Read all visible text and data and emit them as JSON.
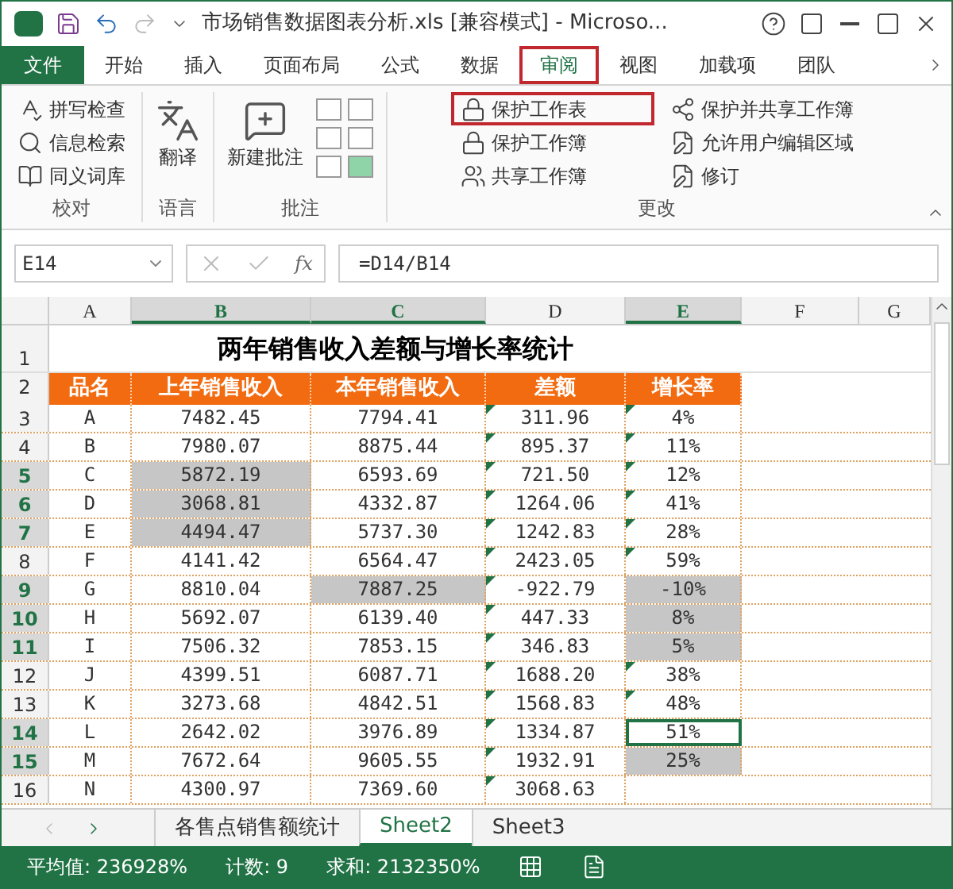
{
  "window": {
    "title": "市场销售数据图表分析.xls  [兼容模式] - Microso..."
  },
  "tabs": [
    {
      "label": "文件",
      "kind": "file",
      "selected": false
    },
    {
      "label": "开始",
      "kind": "tab",
      "selected": false
    },
    {
      "label": "插入",
      "kind": "tab",
      "selected": false
    },
    {
      "label": "页面布局",
      "kind": "tab",
      "selected": false
    },
    {
      "label": "公式",
      "kind": "tab",
      "selected": false
    },
    {
      "label": "数据",
      "kind": "tab",
      "selected": false
    },
    {
      "label": "审阅",
      "kind": "tab",
      "selected": true
    },
    {
      "label": "视图",
      "kind": "tab",
      "selected": false
    },
    {
      "label": "加载项",
      "kind": "tab",
      "selected": false
    },
    {
      "label": "团队",
      "kind": "tab",
      "selected": false
    }
  ],
  "ribbon": {
    "proofing": {
      "label": "校对",
      "items": [
        "拼写检查",
        "信息检索",
        "同义词库"
      ]
    },
    "language": {
      "label": "语言",
      "item": "翻译"
    },
    "comments": {
      "label": "批注",
      "item": "新建批注"
    },
    "changes": {
      "label": "更改",
      "items": [
        {
          "label": "保护工作表",
          "highlighted": true
        },
        {
          "label": "保护并共享工作簿",
          "highlighted": false
        },
        {
          "label": "保护工作簿",
          "highlighted": false
        },
        {
          "label": "允许用户编辑区域",
          "highlighted": false
        },
        {
          "label": "共享工作簿",
          "highlighted": false
        },
        {
          "label": "修订",
          "highlighted": false
        }
      ]
    }
  },
  "formula_bar": {
    "name_box": "E14",
    "function_label": "fx",
    "formula": "=D14/B14"
  },
  "columns": [
    {
      "label": "A",
      "highlighted": false
    },
    {
      "label": "B",
      "highlighted": true
    },
    {
      "label": "C",
      "highlighted": true
    },
    {
      "label": "D",
      "highlighted": false
    },
    {
      "label": "E",
      "highlighted": true
    },
    {
      "label": "F",
      "highlighted": false
    },
    {
      "label": "G",
      "highlighted": false
    }
  ],
  "sheet": {
    "title_row": {
      "number": "1",
      "text": "两年销售收入差额与增长率统计"
    },
    "header_row": {
      "number": "2",
      "cells": [
        "品名",
        "上年销售收入",
        "本年销售收入",
        "差额",
        "增长率"
      ]
    },
    "rows": [
      {
        "number": "3",
        "highlighted": false,
        "cells": [
          {
            "text": "A",
            "selected": false
          },
          {
            "text": "7482.45",
            "selected": false
          },
          {
            "text": "7794.41",
            "selected": false
          },
          {
            "text": "311.96",
            "selected": false,
            "flag": true
          },
          {
            "text": "4%",
            "selected": false,
            "flag": true
          }
        ]
      },
      {
        "number": "4",
        "highlighted": false,
        "cells": [
          {
            "text": "B",
            "selected": false
          },
          {
            "text": "7980.07",
            "selected": false
          },
          {
            "text": "8875.44",
            "selected": false
          },
          {
            "text": "895.37",
            "selected": false,
            "flag": true
          },
          {
            "text": "11%",
            "selected": false,
            "flag": true
          }
        ]
      },
      {
        "number": "5",
        "highlighted": true,
        "cells": [
          {
            "text": "C",
            "selected": false
          },
          {
            "text": "5872.19",
            "selected": true
          },
          {
            "text": "6593.69",
            "selected": false
          },
          {
            "text": "721.50",
            "selected": false,
            "flag": true
          },
          {
            "text": "12%",
            "selected": false,
            "flag": true
          }
        ]
      },
      {
        "number": "6",
        "highlighted": true,
        "cells": [
          {
            "text": "D",
            "selected": false
          },
          {
            "text": "3068.81",
            "selected": true
          },
          {
            "text": "4332.87",
            "selected": false
          },
          {
            "text": "1264.06",
            "selected": false,
            "flag": true
          },
          {
            "text": "41%",
            "selected": false,
            "flag": true
          }
        ]
      },
      {
        "number": "7",
        "highlighted": true,
        "cells": [
          {
            "text": "E",
            "selected": false
          },
          {
            "text": "4494.47",
            "selected": true
          },
          {
            "text": "5737.30",
            "selected": false
          },
          {
            "text": "1242.83",
            "selected": false,
            "flag": true
          },
          {
            "text": "28%",
            "selected": false,
            "flag": true
          }
        ]
      },
      {
        "number": "8",
        "highlighted": false,
        "cells": [
          {
            "text": "F",
            "selected": false
          },
          {
            "text": "4141.42",
            "selected": false
          },
          {
            "text": "6564.47",
            "selected": false
          },
          {
            "text": "2423.05",
            "selected": false,
            "flag": true
          },
          {
            "text": "59%",
            "selected": false,
            "flag": true
          }
        ]
      },
      {
        "number": "9",
        "highlighted": true,
        "cells": [
          {
            "text": "G",
            "selected": false
          },
          {
            "text": "8810.04",
            "selected": false
          },
          {
            "text": "7887.25",
            "selected": true
          },
          {
            "text": "-922.79",
            "selected": false,
            "flag": true
          },
          {
            "text": "-10%",
            "selected": true
          }
        ]
      },
      {
        "number": "10",
        "highlighted": true,
        "cells": [
          {
            "text": "H",
            "selected": false
          },
          {
            "text": "5692.07",
            "selected": false
          },
          {
            "text": "6139.40",
            "selected": false
          },
          {
            "text": "447.33",
            "selected": false,
            "flag": true
          },
          {
            "text": "8%",
            "selected": true
          }
        ]
      },
      {
        "number": "11",
        "highlighted": true,
        "cells": [
          {
            "text": "I",
            "selected": false
          },
          {
            "text": "7506.32",
            "selected": false
          },
          {
            "text": "7853.15",
            "selected": false
          },
          {
            "text": "346.83",
            "selected": false,
            "flag": true
          },
          {
            "text": "5%",
            "selected": true
          }
        ]
      },
      {
        "number": "12",
        "highlighted": false,
        "cells": [
          {
            "text": "J",
            "selected": false
          },
          {
            "text": "4399.51",
            "selected": false
          },
          {
            "text": "6087.71",
            "selected": false
          },
          {
            "text": "1688.20",
            "selected": false,
            "flag": true
          },
          {
            "text": "38%",
            "selected": false,
            "flag": true
          }
        ]
      },
      {
        "number": "13",
        "highlighted": false,
        "cells": [
          {
            "text": "K",
            "selected": false
          },
          {
            "text": "3273.68",
            "selected": false
          },
          {
            "text": "4842.51",
            "selected": false
          },
          {
            "text": "1568.83",
            "selected": false,
            "flag": true
          },
          {
            "text": "48%",
            "selected": false,
            "flag": true
          }
        ]
      },
      {
        "number": "14",
        "highlighted": true,
        "cells": [
          {
            "text": "L",
            "selected": false
          },
          {
            "text": "2642.02",
            "selected": false
          },
          {
            "text": "3976.89",
            "selected": false
          },
          {
            "text": "1334.87",
            "selected": false,
            "flag": true
          },
          {
            "text": "51%",
            "selected": false,
            "active": true
          }
        ]
      },
      {
        "number": "15",
        "highlighted": true,
        "cells": [
          {
            "text": "M",
            "selected": false
          },
          {
            "text": "7672.64",
            "selected": false
          },
          {
            "text": "9605.55",
            "selected": false
          },
          {
            "text": "1932.91",
            "selected": false,
            "flag": true
          },
          {
            "text": "25%",
            "selected": true
          }
        ]
      },
      {
        "number": "16",
        "highlighted": false,
        "cells": [
          {
            "text": "N",
            "selected": false
          },
          {
            "text": "4300.97",
            "selected": false
          },
          {
            "text": "7369.60",
            "selected": false
          },
          {
            "text": "3068.63",
            "selected": false,
            "flag": true
          }
        ]
      }
    ]
  },
  "sheet_tabs": [
    {
      "label": "各售点销售额统计",
      "selected": false
    },
    {
      "label": "Sheet2",
      "selected": true
    },
    {
      "label": "Sheet3",
      "selected": false
    }
  ],
  "status_bar": {
    "average": "平均值: 236928%",
    "count": "计数: 9",
    "sum": "求和: 2132350%"
  }
}
